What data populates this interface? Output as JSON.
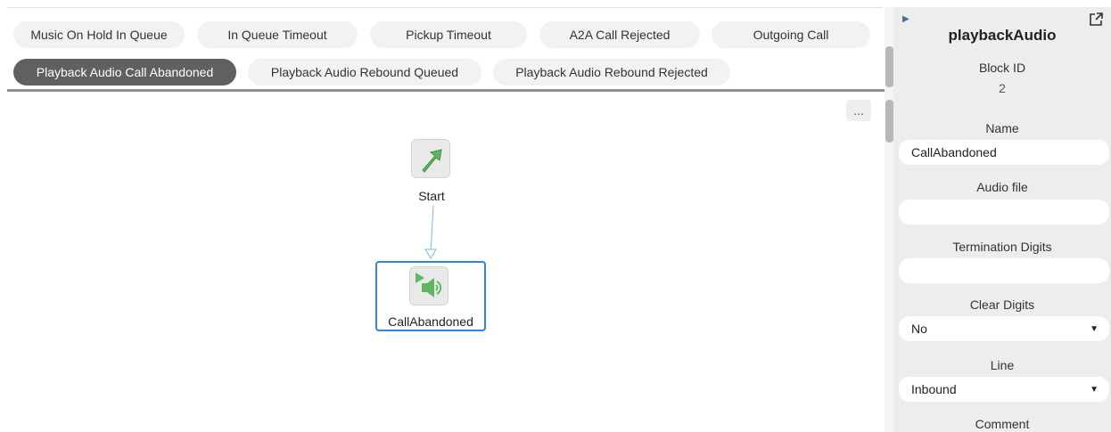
{
  "tabs": [
    {
      "label": "Music On Hold In Queue",
      "active": false
    },
    {
      "label": "In Queue Timeout",
      "active": false
    },
    {
      "label": "Pickup Timeout",
      "active": false
    },
    {
      "label": "A2A Call Rejected",
      "active": false
    },
    {
      "label": "Outgoing Call",
      "active": false
    },
    {
      "label": "Playback Audio Call Abandoned",
      "active": true
    },
    {
      "label": "Playback Audio Rebound Queued",
      "active": false
    },
    {
      "label": "Playback Audio Rebound Rejected",
      "active": false
    }
  ],
  "canvas": {
    "more_label": "...",
    "start_node": {
      "label": "Start",
      "icon": "start-arrow-icon"
    },
    "playback_node": {
      "label": "CallAbandoned",
      "icon": "playback-audio-icon",
      "selected": true
    }
  },
  "panel": {
    "title": "playbackAudio",
    "block_id_label": "Block ID",
    "block_id_value": "2",
    "name_label": "Name",
    "name_value": "CallAbandoned",
    "audio_file_label": "Audio file",
    "audio_file_value": "",
    "termination_digits_label": "Termination Digits",
    "termination_digits_value": "",
    "clear_digits_label": "Clear Digits",
    "clear_digits_value": "No",
    "line_label": "Line",
    "line_value": "Inbound",
    "comment_label": "Comment"
  },
  "colors": {
    "active_tab": "#606060",
    "tab_bg": "#f1f2f4",
    "selection": "#2b87e3",
    "panel_bg": "#ededed",
    "icon_green": "#5fb85f"
  }
}
